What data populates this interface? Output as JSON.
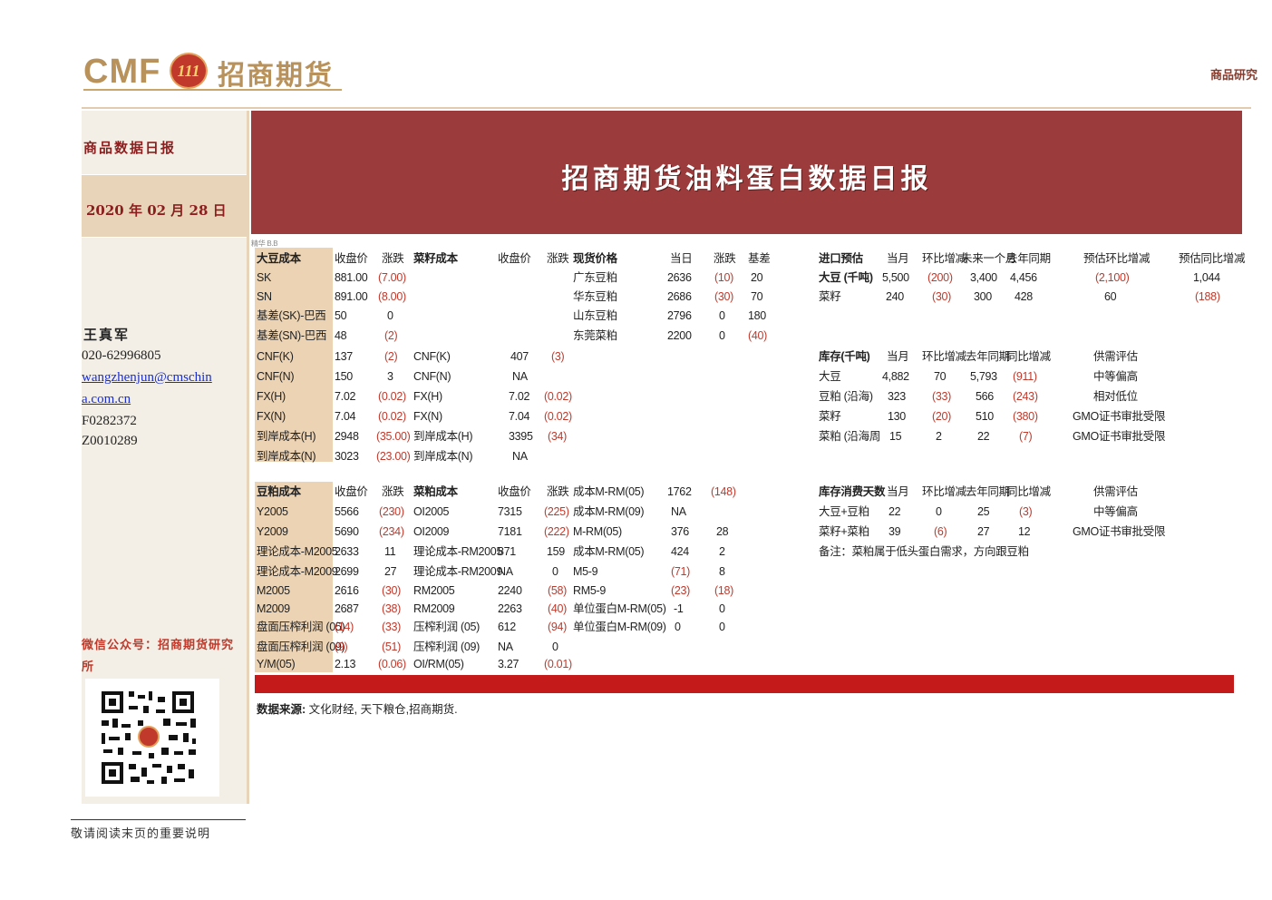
{
  "header": {
    "logo_text": "CMF",
    "logo_mark": "111",
    "logo_cn": "招商期货",
    "right_label": "商品研究"
  },
  "sidebar": {
    "title": "商品数据日报",
    "date": "2020 年 02 月 28 日",
    "author": "王真军",
    "phone": "020-62996805",
    "email_line1": "wangzhenjun@cmschin",
    "email_line2": "a.com.cn",
    "cert1": "F0282372",
    "cert2": "Z0010289",
    "wechat": "微信公众号：招商期货研究所"
  },
  "banner": {
    "title": "招商期货油料蛋白数据日报"
  },
  "table_tag": "精华 B.B",
  "soy_cost": {
    "headers": [
      "大豆成本",
      "收盘价",
      "涨跌"
    ],
    "rows": [
      [
        "SK",
        "881.00",
        "(7.00)"
      ],
      [
        "SN",
        "891.00",
        "(8.00)"
      ],
      [
        "基差(SK)-巴西",
        "50",
        "0"
      ],
      [
        "基差(SN)-巴西",
        "48",
        "(2)"
      ],
      [
        "CNF(K)",
        "137",
        "(2)"
      ],
      [
        "CNF(N)",
        "150",
        "3"
      ],
      [
        "FX(H)",
        "7.02",
        "(0.02)"
      ],
      [
        "FX(N)",
        "7.04",
        "(0.02)"
      ],
      [
        "到岸成本(H)",
        "2948",
        "(35.00)"
      ],
      [
        "到岸成本(N)",
        "3023",
        "(23.00)"
      ]
    ]
  },
  "rapeseed_cost": {
    "headers": [
      "菜籽成本",
      "收盘价",
      "涨跌"
    ],
    "rows": [
      [
        "CNF(K)",
        "407",
        "(3)"
      ],
      [
        "CNF(N)",
        "NA",
        ""
      ],
      [
        "FX(H)",
        "7.02",
        "(0.02)"
      ],
      [
        "FX(N)",
        "7.04",
        "(0.02)"
      ],
      [
        "到岸成本(H)",
        "3395",
        "(34)"
      ],
      [
        "到岸成本(N)",
        "NA",
        ""
      ]
    ]
  },
  "spot": {
    "headers": [
      "现货价格",
      "当日",
      "涨跌",
      "基差"
    ],
    "rows": [
      [
        "广东豆粕",
        "2636",
        "(10)",
        "20"
      ],
      [
        "华东豆粕",
        "2686",
        "(30)",
        "70"
      ],
      [
        "山东豆粕",
        "2796",
        "0",
        "180"
      ],
      [
        "东莞菜粕",
        "2200",
        "0",
        "(40)"
      ]
    ]
  },
  "import_forecast": {
    "headers": [
      "进口预估",
      "当月",
      "环比增减",
      "未来一个月",
      "去年同期",
      "预估环比增减",
      "预估同比增减"
    ],
    "rows": [
      [
        "大豆 (千吨)",
        "5,500",
        "(200)",
        "3,400",
        "4,456",
        "(2,100)",
        "1,044"
      ],
      [
        "菜籽",
        "240",
        "(30)",
        "300",
        "428",
        "60",
        "(188)"
      ]
    ]
  },
  "inventory": {
    "headers": [
      "库存(千吨)",
      "当月",
      "环比增减",
      "去年同期",
      "同比增减",
      "供需评估"
    ],
    "rows": [
      [
        "大豆",
        "4,882",
        "70",
        "5,793",
        "(911)",
        "中等偏高"
      ],
      [
        "豆粕 (沿海)",
        "323",
        "(33)",
        "566",
        "(243)",
        "相对低位"
      ],
      [
        "菜籽",
        "130",
        "(20)",
        "510",
        "(380)",
        "GMO证书审批受限"
      ],
      [
        "菜粕 (沿海周",
        "15",
        "2",
        "22",
        "(7)",
        "GMO证书审批受限"
      ]
    ]
  },
  "meal_cost": {
    "headers": [
      "豆粕成本",
      "收盘价",
      "涨跌"
    ],
    "rows": [
      [
        "Y2005",
        "5566",
        "(230)"
      ],
      [
        "Y2009",
        "5690",
        "(234)"
      ],
      [
        "理论成本-M2005",
        "2633",
        "11"
      ],
      [
        "理论成本-M2009",
        "2699",
        "27"
      ],
      [
        "M2005",
        "2616",
        "(30)"
      ],
      [
        "M2009",
        "2687",
        "(38)"
      ],
      [
        "盘面压榨利润 (05)",
        "(14)",
        "(33)"
      ],
      [
        "盘面压榨利润 (09)",
        "(9)",
        "(51)"
      ],
      [
        "Y/M(05)",
        "2.13",
        "(0.06)"
      ]
    ]
  },
  "rapemeal_cost": {
    "headers": [
      "菜粕成本",
      "收盘价",
      "涨跌"
    ],
    "rows": [
      [
        "OI2005",
        "7315",
        "(225)"
      ],
      [
        "OI2009",
        "7181",
        "(222)"
      ],
      [
        "理论成本-RM2005",
        "871",
        "159"
      ],
      [
        "理论成本-RM2009",
        "NA",
        "0"
      ],
      [
        "RM2005",
        "2240",
        "(58)"
      ],
      [
        "RM2009",
        "2263",
        "(40)"
      ],
      [
        "压榨利润 (05)",
        "612",
        "(94)"
      ],
      [
        "压榨利润 (09)",
        "NA",
        "0"
      ],
      [
        "OI/RM(05)",
        "3.27",
        "(0.01)"
      ]
    ]
  },
  "spreads": {
    "rows": [
      [
        "成本M-RM(05)",
        "1762",
        "(148)"
      ],
      [
        "成本M-RM(09)",
        "NA",
        ""
      ],
      [
        "M-RM(05)",
        "376",
        "28"
      ],
      [
        "成本M-RM(05)",
        "424",
        "2"
      ],
      [
        "M5-9",
        "(71)",
        "8"
      ],
      [
        "RM5-9",
        "(23)",
        "(18)"
      ],
      [
        "单位蛋白M-RM(05)",
        "-1",
        "0"
      ],
      [
        "单位蛋白M-RM(09)",
        "0",
        "0"
      ]
    ]
  },
  "consumption_days": {
    "headers": [
      "库存消费天数",
      "当月",
      "环比增减",
      "去年同期",
      "同比增减",
      "供需评估"
    ],
    "rows": [
      [
        "大豆+豆粕",
        "22",
        "0",
        "25",
        "(3)",
        "中等偏高"
      ],
      [
        "菜籽+菜粕",
        "39",
        "(6)",
        "27",
        "12",
        "GMO证书审批受限"
      ]
    ],
    "note": "备注：菜粕属于低头蛋白需求，方向跟豆粕"
  },
  "source_label": "数据来源:",
  "source_text": " 文化财经, 天下粮仓,招商期货.",
  "footer_note": "敬请阅读末页的重要说明",
  "colors": {
    "banner": "#9b3b3b",
    "accent_red": "#c0392b",
    "shade": "#ecd3b4",
    "bar": "#c41a1a"
  }
}
